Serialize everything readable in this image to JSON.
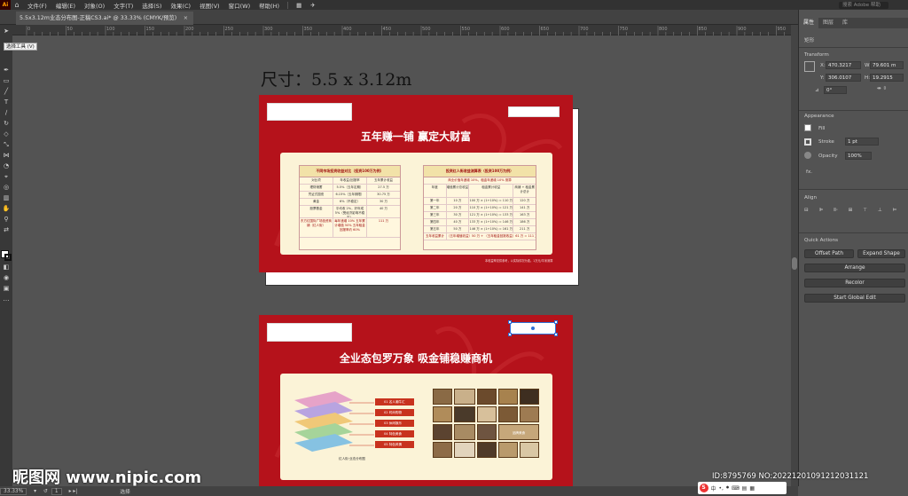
{
  "menu": {
    "logo": "Ai",
    "items": [
      "文件(F)",
      "编辑(E)",
      "对象(O)",
      "文字(T)",
      "选择(S)",
      "效果(C)",
      "视图(V)",
      "窗口(W)",
      "帮助(H)"
    ],
    "search_placeholder": "搜索 Adobe 帮助"
  },
  "document_tab": {
    "label": "5.5x3.12m业态分布图-正稿CS3.ai* @ 33.33% (CMYK/预览)",
    "close": "×"
  },
  "ruler_ticks": [
    "0",
    "50",
    "100",
    "150",
    "200",
    "250",
    "300",
    "350",
    "400",
    "450",
    "500",
    "550",
    "600",
    "650",
    "700",
    "750",
    "800",
    "850",
    "900",
    "950"
  ],
  "tooltip": "选择工具 (V)",
  "status": {
    "zoom": "33.33%",
    "artboard": "1",
    "tool": "选择"
  },
  "canvas": {
    "dimension_title": "尺寸：5.5 x 3.12m"
  },
  "artboard1": {
    "title": "五年赚一铺  赢定大财富",
    "left_table": {
      "title": "不同市场投资收益对比（投资100万为例）",
      "headers": [
        "对比项",
        "年收益/回报率",
        "五年累计收益"
      ],
      "rows": [
        [
          "理财储蓄",
          "5.5%（五年定期）",
          "27.5 万"
        ],
        [
          "凭证式国债",
          "6.15%（五年期限）",
          "30.75 万"
        ],
        [
          "黄金",
          "6%（不稳定）",
          "30 万"
        ],
        [
          "股票基金",
          "平均收 2%，好年成 5%（受经济影响不稳定）",
          "40 万"
        ],
        [
          "东方红国际广场投资商铺（红人街）",
          "每年递增 10%  五年累计增值 50%  五年租金回报率约 60%",
          "111 万"
        ]
      ]
    },
    "right_table": {
      "title": "投资红人街收益测算表（投资100万为例）",
      "subtitle": "商业价值年递增 10%，租金年递增 10% 测算",
      "headers": [
        "年度",
        "增值累计总收益",
        "租金累计收益",
        "商铺 + 租金累计总计"
      ],
      "rows": [
        [
          "第一年",
          "10 万",
          "100 万 × (1+10%) = 110 万",
          "120 万"
        ],
        [
          "第二年",
          "20 万",
          "110 万 × (1+10%) = 121 万",
          "141 万"
        ],
        [
          "第三年",
          "30 万",
          "121 万 × (1+10%) = 133 万",
          "163 万"
        ],
        [
          "第四年",
          "40 万",
          "133 万 × (1+10%) = 146 万",
          "186 万"
        ],
        [
          "第五年",
          "50 万",
          "146 万 × (1+10%) = 161 万",
          "211 万"
        ]
      ],
      "total_row": [
        "五年收益累计",
        "（五年增值收益）50 万 + （五年租金回报收益）61 万 = 111 万"
      ]
    },
    "footnote": "本收益率仅供参考，以实际情况为准。1万元/平米测算"
  },
  "artboard2": {
    "title": "全业态包罗万象  吸金铺稳赚商机",
    "diagram_caption": "红人街·业态分布图",
    "chips": [
      "01  名人潮牛汇",
      "02  时尚购物",
      "03  休闲娱乐",
      "04  特色美食",
      "05  特色风情"
    ],
    "photo_label": "品牌美食"
  },
  "panel": {
    "tabs": [
      "属性",
      "图层",
      "库"
    ],
    "object_type": "矩形",
    "transform_label": "Transform",
    "x_label": "X:",
    "x_value": "470.3217",
    "y_label": "Y:",
    "y_value": "306.0107",
    "w_label": "W:",
    "w_value": "79.601 m",
    "h_label": "H:",
    "h_value": "19.2915",
    "angle_value": "0°",
    "appearance_label": "Appearance",
    "fill_label": "Fill",
    "stroke_label": "Stroke",
    "stroke_value": "1 pt",
    "opacity_label": "Opacity",
    "opacity_value": "100%",
    "fx_label": "fx.",
    "align_label": "Align",
    "quick_actions_label": "Quick Actions",
    "offset_path": "Offset Path",
    "expand_shape": "Expand Shape",
    "arrange": "Arrange",
    "recolor": "Recolor",
    "global_edit": "Start Global Edit"
  },
  "watermark": {
    "left": "昵图网 www.nipic.com",
    "right": "ID:8795769 NO:20221201091212031121"
  },
  "ime": {
    "logo": "S",
    "lang": "中"
  },
  "colors": {
    "board_red": "#b5121b",
    "cream": "#fbf3d7",
    "app_bg": "#535353"
  }
}
